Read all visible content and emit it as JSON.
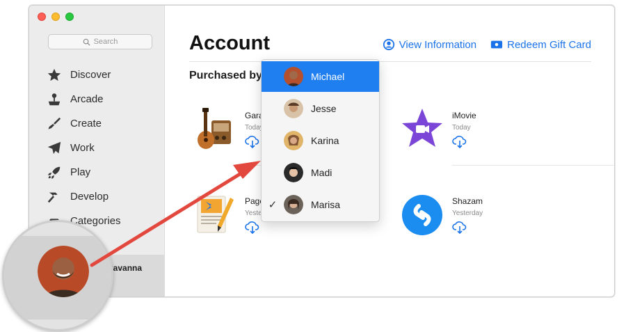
{
  "search": {
    "placeholder": "Search"
  },
  "sidebar": {
    "items": [
      {
        "label": "Discover",
        "icon": "star-icon"
      },
      {
        "label": "Arcade",
        "icon": "joystick-icon"
      },
      {
        "label": "Create",
        "icon": "brush-icon"
      },
      {
        "label": "Work",
        "icon": "paper-plane-icon"
      },
      {
        "label": "Play",
        "icon": "rocket-icon"
      },
      {
        "label": "Develop",
        "icon": "hammer-icon"
      },
      {
        "label": "Categories",
        "icon": "stack-icon"
      }
    ],
    "user_name": "Cavanna"
  },
  "main": {
    "title": "Account",
    "view_info": "View Information",
    "redeem": "Redeem Gift Card",
    "purchased_by": "Purchased by",
    "apps": [
      {
        "name": "Gara",
        "date": "Today"
      },
      {
        "name": "iMovie",
        "date": "Today"
      },
      {
        "name": "Page",
        "date": "Yeste"
      },
      {
        "name": "Shazam",
        "date": "Yesterday"
      }
    ]
  },
  "menu": {
    "items": [
      {
        "label": "Michael",
        "selected": true,
        "checked": false
      },
      {
        "label": "Jesse",
        "selected": false,
        "checked": false
      },
      {
        "label": "Karina",
        "selected": false,
        "checked": false
      },
      {
        "label": "Madi",
        "selected": false,
        "checked": false
      },
      {
        "label": "Marisa",
        "selected": false,
        "checked": true
      }
    ]
  },
  "colors": {
    "accent": "#1f7ef0",
    "link": "#1a73e8",
    "arrow": "#e2483d"
  }
}
